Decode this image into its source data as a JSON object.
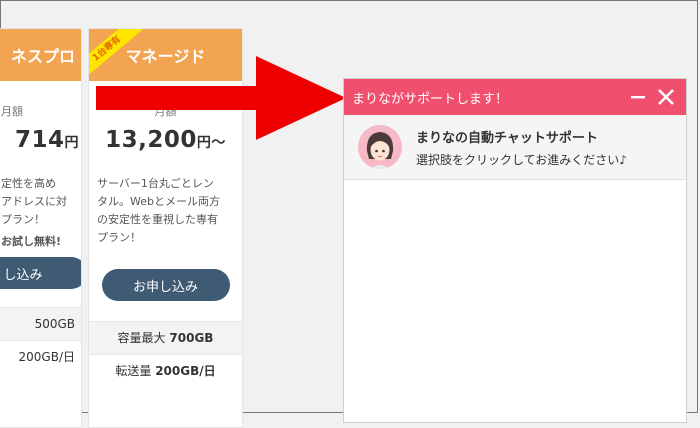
{
  "cards": [
    {
      "name": "ネスプロ",
      "badge": "",
      "price_label": "月額",
      "price": "714",
      "unit": "円",
      "desc": [
        "定性を高め",
        "アドレスに対",
        "プラン！"
      ],
      "trial": "お試し無料!",
      "button": "し込み",
      "spec1_label": "",
      "spec1_value": "500GB",
      "spec2_label": "",
      "spec2_value": "200GB/日"
    },
    {
      "name": "マネージド",
      "badge": "1台専有",
      "price_label": "月額",
      "price": "13,200",
      "unit": "円〜",
      "desc": [
        "サーバー1台丸ごとレン",
        "タル。Webとメール両方",
        "の安定性を重視した専有",
        "プラン！"
      ],
      "trial": "",
      "button": "お申し込み",
      "spec1_label": "容量最大",
      "spec1_value": "700GB",
      "spec2_label": "転送量",
      "spec2_value": "200GB/日"
    }
  ],
  "arrow_color": "#ee0000",
  "chat": {
    "title": "まりながサポートします！",
    "minimize_icon": "minimize-icon",
    "close_icon": "close-icon",
    "agent_name": "まりなの自動チャットサポート",
    "agent_message": "選択肢をクリックしてお進みください♪",
    "header_color": "#f0506e"
  },
  "colors": {
    "card_header": "#f2a452",
    "button": "#3f5a73",
    "badge": "#ffe600"
  }
}
